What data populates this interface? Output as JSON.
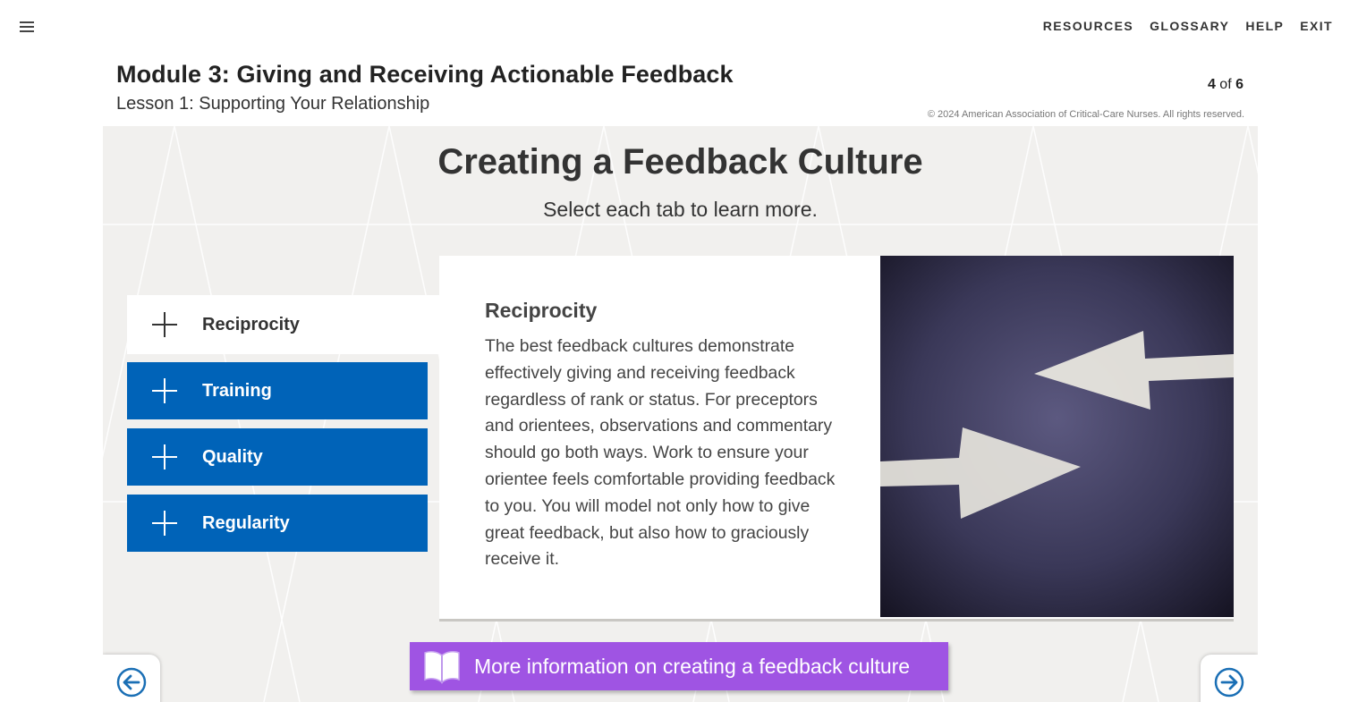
{
  "header": {
    "menu_icon": "hamburger-menu-icon",
    "nav": [
      "RESOURCES",
      "GLOSSARY",
      "HELP",
      "EXIT"
    ],
    "module_title": "Module 3: Giving and Receiving Actionable Feedback",
    "lesson_title": "Lesson 1: Supporting Your Relationship",
    "page_current": "4",
    "page_of": "of",
    "page_total": "6",
    "copyright": "© 2024 American Association of  Critical-Care Nurses. All rights reserved."
  },
  "stage": {
    "title": "Creating a Feedback Culture",
    "subtitle": "Select each tab to learn more.",
    "tabs": [
      {
        "label": "Reciprocity",
        "icon": "plus-icon",
        "active": true
      },
      {
        "label": "Training",
        "icon": "plus-icon",
        "active": false
      },
      {
        "label": "Quality",
        "icon": "plus-icon",
        "active": false
      },
      {
        "label": "Regularity",
        "icon": "plus-icon",
        "active": false
      }
    ],
    "panel": {
      "heading": "Reciprocity",
      "body": "The best feedback cultures demonstrate effectively giving and receiving feedback regardless of rank or status. For preceptors and orientees, observations and commentary should go both ways. Work to ensure your orientee feels comfortable providing feedback to you. You will model not only how to give great feedback, but also how to graciously receive it.",
      "image": "opposing-arrows-on-asphalt"
    },
    "more_button": {
      "label": "More information on creating a feedback culture",
      "icon": "open-book-icon"
    },
    "nav_prev_icon": "arrow-left-circle-icon",
    "nav_next_icon": "arrow-right-circle-icon"
  },
  "colors": {
    "tab_blue": "#0063b8",
    "more_purple": "#9f54e3",
    "stage_bg": "#f1f0ee",
    "nav_arrow_blue": "#1a6fb5"
  }
}
